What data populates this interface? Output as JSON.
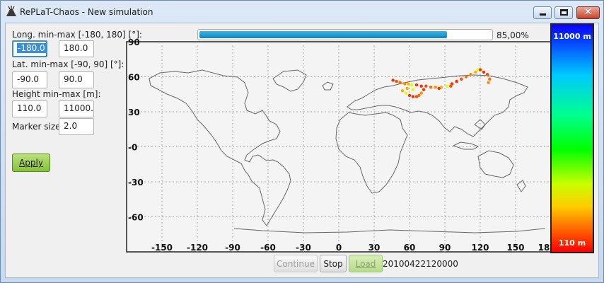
{
  "window": {
    "title": "RePLaT-Chaos - New simulation",
    "close_glyph": "✕"
  },
  "controls": {
    "long_label": "Long. min-max [-180, 180] [°]:",
    "long_min": "-180.0",
    "long_max": "180.0",
    "lat_label": "Lat. min-max [-90, 90] [°]:",
    "lat_min": "-90.0",
    "lat_max": "90.0",
    "height_label": "Height min-max [m]:",
    "height_min": "110.0",
    "height_max": "11000.",
    "marker_label": "Marker size:",
    "marker_size": "2.0",
    "apply_label": "Apply"
  },
  "progress": {
    "value": 0.85,
    "text": "85,00%"
  },
  "colorbar": {
    "top_label": "11000 m",
    "bottom_label": "110 m"
  },
  "map": {
    "x_ticks": [
      "-150",
      "-120",
      "-90",
      "-60",
      "-30",
      "0",
      "30",
      "60",
      "90",
      "120",
      "150",
      "18"
    ],
    "y_ticks": [
      "90",
      "60",
      "30",
      "-0",
      "-30",
      "-60"
    ]
  },
  "chart_data": {
    "type": "scatter",
    "xlim": [
      -180,
      180
    ],
    "ylim": [
      -90,
      90
    ],
    "grid": true,
    "points": [
      {
        "x": 46,
        "y": 57
      },
      {
        "x": 49,
        "y": 56
      },
      {
        "x": 52,
        "y": 55
      },
      {
        "x": 56,
        "y": 54
      },
      {
        "x": 59,
        "y": 54
      },
      {
        "x": 62,
        "y": 53
      },
      {
        "x": 66,
        "y": 53
      },
      {
        "x": 70,
        "y": 52
      },
      {
        "x": 74,
        "y": 52
      },
      {
        "x": 78,
        "y": 51
      },
      {
        "x": 82,
        "y": 51
      },
      {
        "x": 87,
        "y": 51
      },
      {
        "x": 92,
        "y": 52
      },
      {
        "x": 96,
        "y": 54
      },
      {
        "x": 100,
        "y": 56
      },
      {
        "x": 104,
        "y": 58
      },
      {
        "x": 108,
        "y": 60
      },
      {
        "x": 112,
        "y": 62
      },
      {
        "x": 116,
        "y": 64
      },
      {
        "x": 118,
        "y": 66
      },
      {
        "x": 120,
        "y": 66
      },
      {
        "x": 123,
        "y": 64
      },
      {
        "x": 126,
        "y": 62
      },
      {
        "x": 128,
        "y": 58
      },
      {
        "x": 127,
        "y": 55
      },
      {
        "x": 54,
        "y": 48
      },
      {
        "x": 57,
        "y": 46
      },
      {
        "x": 60,
        "y": 44
      },
      {
        "x": 63,
        "y": 43
      },
      {
        "x": 66,
        "y": 43
      },
      {
        "x": 68,
        "y": 44
      },
      {
        "x": 70,
        "y": 46
      },
      {
        "x": 58,
        "y": 50
      },
      {
        "x": 63,
        "y": 49
      },
      {
        "x": 72,
        "y": 49
      },
      {
        "x": 85,
        "y": 50
      },
      {
        "x": 95,
        "y": 52
      }
    ]
  },
  "buttons": {
    "continue": "Continue",
    "stop": "Stop",
    "load": "Load"
  },
  "timestamp": "20100422120000"
}
